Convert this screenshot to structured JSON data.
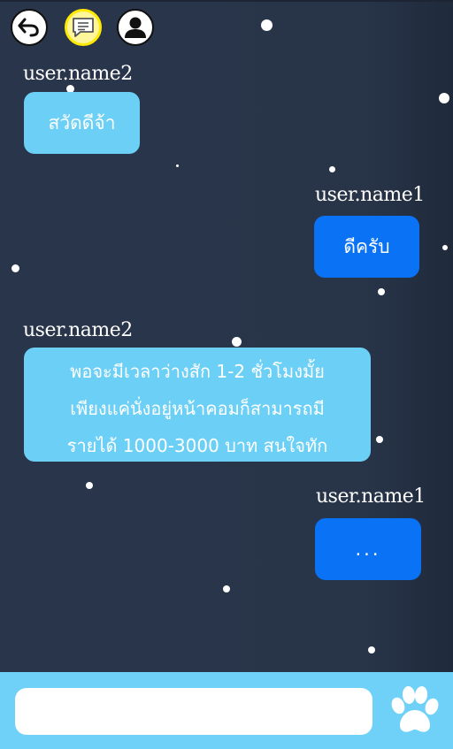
{
  "header": {
    "icons": [
      "back-arrow-icon",
      "chat-bubble-icon",
      "user-profile-icon"
    ]
  },
  "messages": [
    {
      "sender": "user.name2",
      "text": "สวัดดีจ้า",
      "side": "left"
    },
    {
      "sender": "user.name1",
      "text": "ดีครับ",
      "side": "right"
    },
    {
      "sender": "user.name2",
      "lines": [
        "พอจะมีเวลาว่างสัก 1-2 ชั่วโมงมั้ย",
        "เพียงแค่นั่งอยู่หน้าคอมก็สามารถมี",
        "รายได้ 1000-3000 บาท สนใจทัก"
      ],
      "side": "left"
    },
    {
      "sender": "user.name1",
      "text": "...",
      "side": "right"
    }
  ],
  "composer": {
    "placeholder": "",
    "send_icon": "paw-icon"
  },
  "colors": {
    "background": "#283549",
    "incoming_bubble": "#6ccff5",
    "outgoing_bubble": "#0a72f5",
    "bottom_bar": "#6fd1f7",
    "active_icon_ring": "#ffea00"
  }
}
